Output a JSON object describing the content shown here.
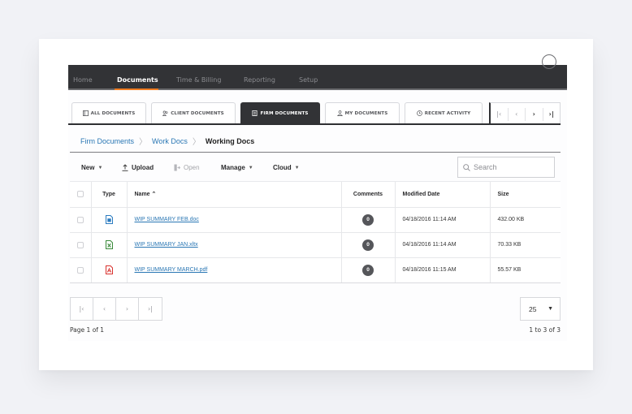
{
  "topnav": {
    "items": [
      {
        "label": "Home",
        "active": false
      },
      {
        "label": "Documents",
        "active": true
      },
      {
        "label": "Time & Billing",
        "active": false
      },
      {
        "label": "Reporting",
        "active": false
      },
      {
        "label": "Setup",
        "active": false
      }
    ],
    "accent_color": "#ef7d22"
  },
  "tabs": [
    {
      "label": "ALL DOCUMENTS",
      "icon": "documents-icon",
      "active": false
    },
    {
      "label": "CLIENT DOCUMENTS",
      "icon": "clients-icon",
      "active": false
    },
    {
      "label": "FIRM DOCUMENTS",
      "icon": "building-icon",
      "active": true
    },
    {
      "label": "MY DOCUMENTS",
      "icon": "user-icon",
      "active": false
    },
    {
      "label": "RECENT ACTIVITY",
      "icon": "clock-icon",
      "active": false
    }
  ],
  "tab_pager": {
    "first": "|<",
    "prev": "<",
    "next": ">",
    "last": ">|"
  },
  "breadcrumb": {
    "items": [
      "Firm Documents",
      "Work Docs"
    ],
    "current": "Working Docs",
    "separator": ">"
  },
  "toolbar": {
    "new_label": "New",
    "upload_label": "Upload",
    "open_label": "Open",
    "manage_label": "Manage",
    "cloud_label": "Cloud",
    "search_placeholder": "Search"
  },
  "table": {
    "columns": {
      "type": "Type",
      "name": "Name ^",
      "comments": "Comments",
      "modified": "Modified Date",
      "size": "Size"
    },
    "rows": [
      {
        "type": "word",
        "name": "WIP SUMMARY FEB.doc",
        "comments": "0",
        "modified": "04/18/2016 11:14 AM",
        "size": "432.00 KB"
      },
      {
        "type": "excel",
        "name": "WIP SUMMARY JAN.xltx",
        "comments": "0",
        "modified": "04/18/2016 11:14 AM",
        "size": "70.33 KB"
      },
      {
        "type": "pdf",
        "name": "WIP SUMMARY MARCH.pdf",
        "comments": "0",
        "modified": "04/18/2016 11:15 AM",
        "size": "55.57 KB"
      }
    ],
    "type_colors": {
      "word": "#2b7bc0",
      "excel": "#3a8a3a",
      "pdf": "#d9322e"
    }
  },
  "footer": {
    "pager": {
      "first": "|<",
      "prev": "<",
      "next": ">",
      "last": ">|"
    },
    "page_info": "Page 1 of 1",
    "per_page": "25",
    "range_info": "1 to 3 of 3"
  }
}
